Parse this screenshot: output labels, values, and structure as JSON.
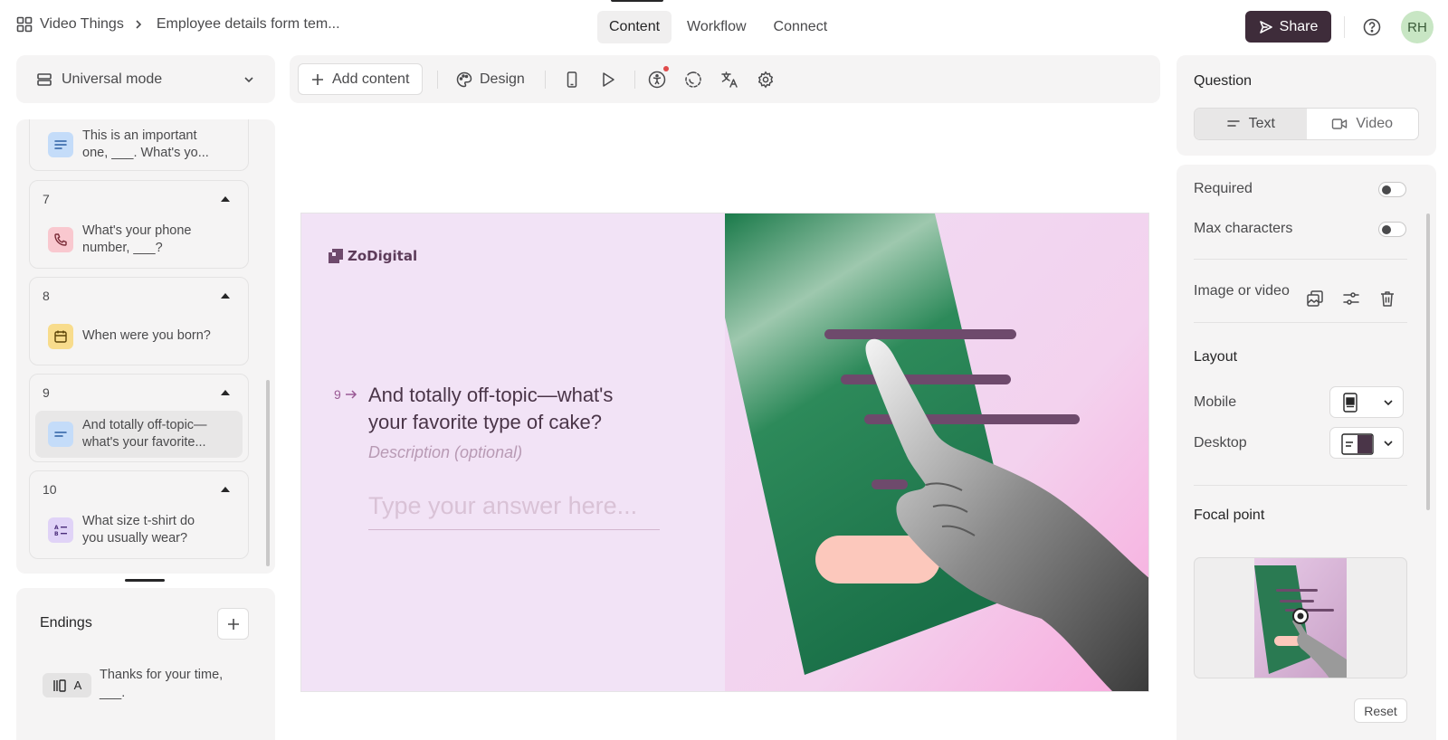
{
  "breadcrumb": {
    "workspace": "Video Things",
    "form_name": "Employee details form tem..."
  },
  "nav_tabs": [
    {
      "label": "Content",
      "active": true
    },
    {
      "label": "Workflow",
      "active": false
    },
    {
      "label": "Connect",
      "active": false
    }
  ],
  "share_label": "Share",
  "avatar_initials": "RH",
  "sidebar": {
    "mode_label": "Universal mode",
    "questions": [
      {
        "number": "",
        "text_line1": "This is an important",
        "text_line2": "one, ___. What's yo...",
        "icon": "short-text-icon",
        "icon_color": "#c4dcf9"
      },
      {
        "number": "7",
        "text_line1": "What's your phone",
        "text_line2": "number, ___?",
        "icon": "phone-icon",
        "icon_color": "#f9c8cf"
      },
      {
        "number": "8",
        "text_line1": "When were you born?",
        "text_line2": "",
        "icon": "calendar-icon",
        "icon_color": "#f8dc8c"
      },
      {
        "number": "9",
        "text_line1": "And totally off-topic—",
        "text_line2": "what's your favorite...",
        "icon": "short-text-icon",
        "icon_color": "#c4dcf9",
        "selected": true
      },
      {
        "number": "10",
        "text_line1": "What size t-shirt do",
        "text_line2": "you usually wear?",
        "icon": "multiple-choice-icon",
        "icon_color": "#e0d3f7"
      }
    ],
    "endings": {
      "title": "Endings",
      "items": [
        {
          "badge": "A",
          "text_line1": "Thanks for your time,",
          "text_line2": "___."
        }
      ]
    }
  },
  "toolbar": {
    "add_content_label": "Add content",
    "design_label": "Design",
    "icons": [
      "mobile-preview-icon",
      "play-icon",
      "accessibility-icon",
      "loading-icon",
      "translate-icon",
      "settings-icon"
    ]
  },
  "preview": {
    "logo_text": "ZoDigital",
    "question_number": "9",
    "question_line1": "And totally off-topic—what's",
    "question_line2": "your favorite type of cake?",
    "description_placeholder": "Description (optional)",
    "answer_placeholder": "Type your answer here..."
  },
  "right_panel": {
    "question_title": "Question",
    "question_types": [
      {
        "label": "Text",
        "active": true
      },
      {
        "label": "Video",
        "active": false
      }
    ],
    "required_label": "Required",
    "required_on": false,
    "max_characters_label": "Max characters",
    "max_characters_on": false,
    "image_or_video_label": "Image or video",
    "layout_title": "Layout",
    "mobile_label": "Mobile",
    "desktop_label": "Desktop",
    "focal_point_title": "Focal point",
    "reset_label": "Reset"
  },
  "colors": {
    "share_button": "#3e2c3a",
    "panel_background": "#f5f4f4",
    "preview_background": "#f2e3f6",
    "preview_text": "#4a3548",
    "brand_purple": "#6e4a6c",
    "art_green": "#1d7a4c",
    "art_peach": "#fcc8bc",
    "art_pink": "#f7a8da"
  }
}
